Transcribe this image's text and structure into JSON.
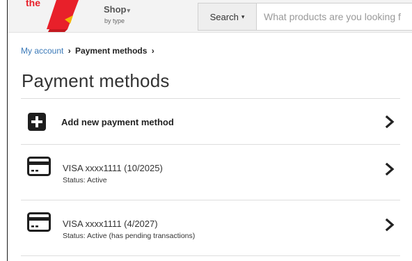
{
  "header": {
    "shop_label": "Shop",
    "shop_sub": "by type",
    "search_button_label": "Search",
    "search_placeholder": "What products are you looking f"
  },
  "breadcrumb": {
    "link_label": "My account",
    "current_label": "Payment methods"
  },
  "page": {
    "title": "Payment methods"
  },
  "payment_methods": {
    "add_label": "Add new payment method",
    "cards": [
      {
        "title": "VISA xxxx1111 (10/2025)",
        "status": "Status: Active"
      },
      {
        "title": "VISA xxxx1111 (4/2027)",
        "status": "Status: Active (has pending transactions)"
      }
    ]
  },
  "colors": {
    "link": "#3a79b8",
    "logo_red": "#e8202a",
    "header_bg": "#f3f3f3",
    "icon_dark": "#1e1e1e"
  },
  "icons": {
    "add": "plus-square-icon",
    "card": "credit-card-icon",
    "chevron": "chevron-right-icon",
    "caret": "caret-down-icon"
  }
}
